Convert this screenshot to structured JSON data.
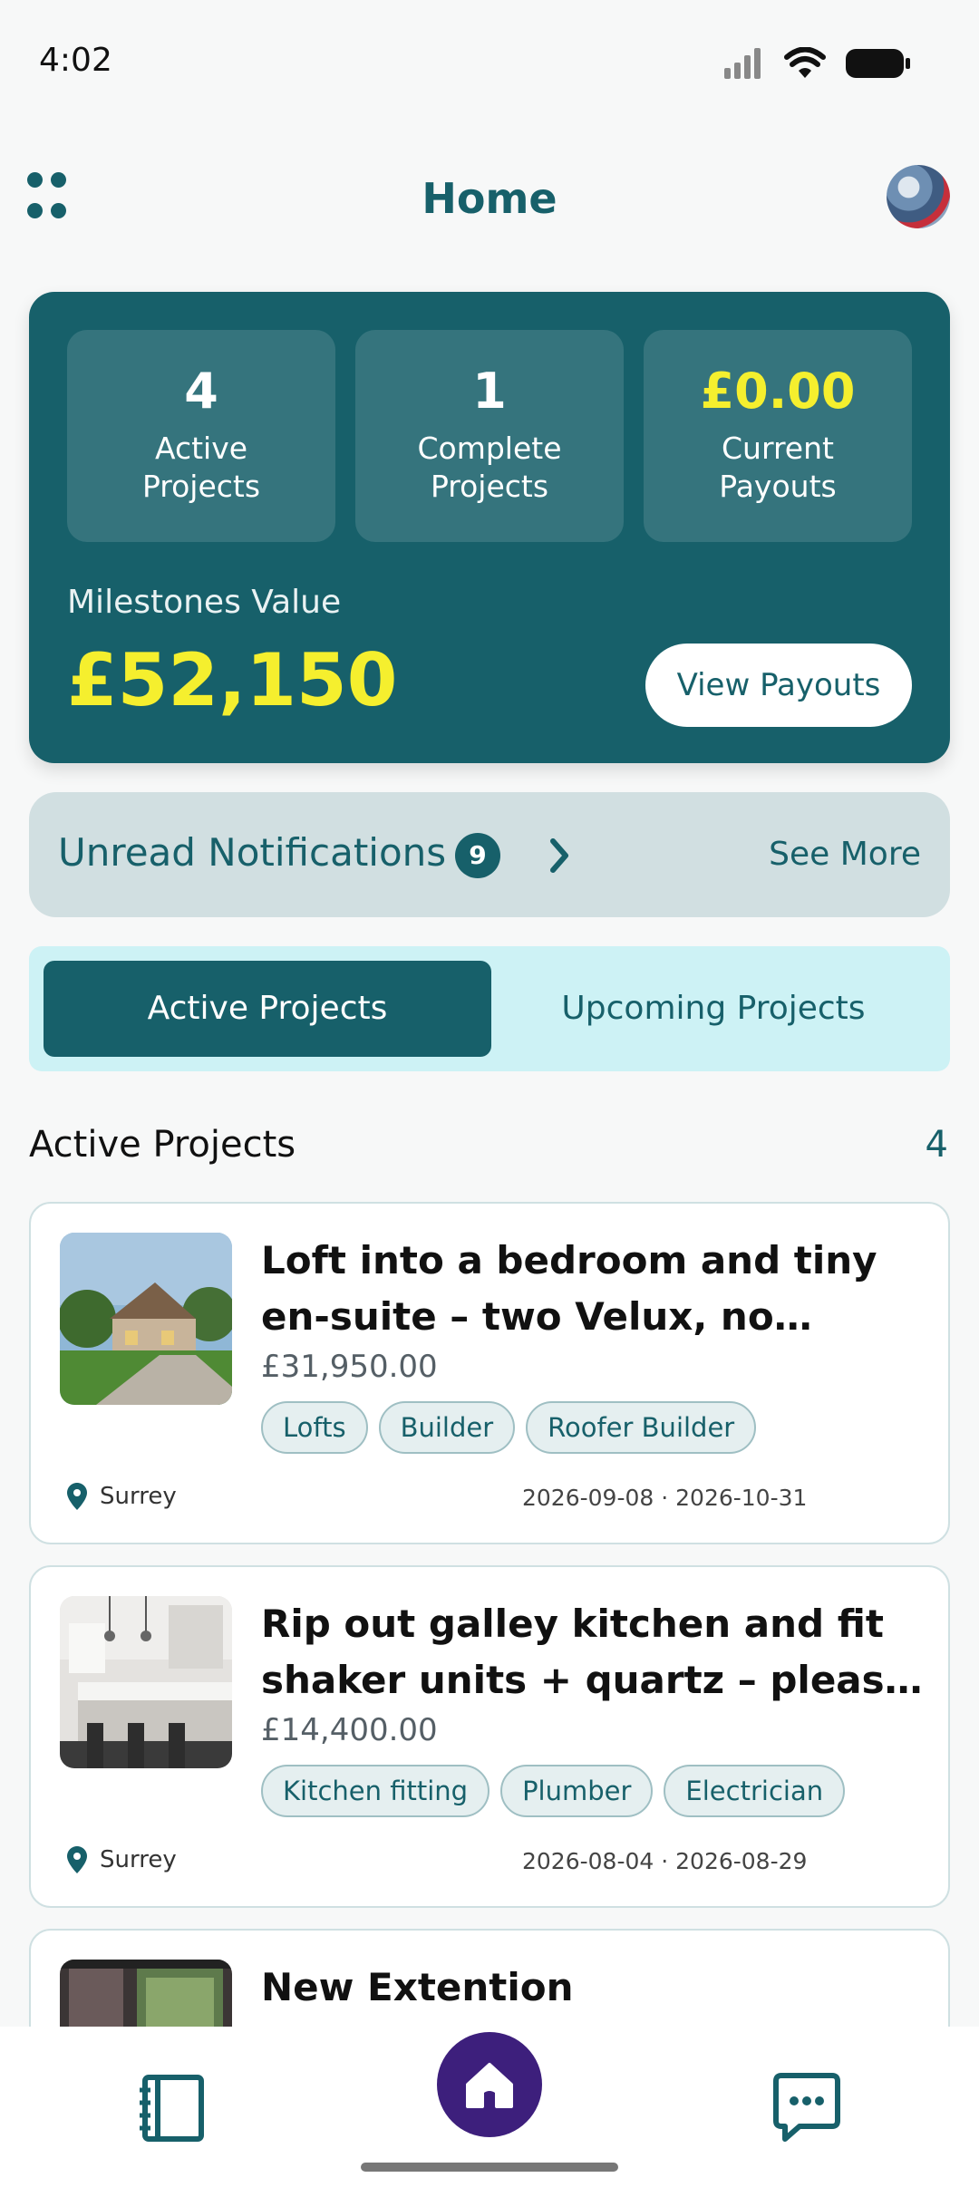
{
  "status": {
    "time": "4:02"
  },
  "header": {
    "title": "Home"
  },
  "stats": [
    {
      "value": "4",
      "label": "Active\nProjects"
    },
    {
      "value": "1",
      "label": "Complete\nProjects"
    },
    {
      "value": "£0.00",
      "label": "Current\nPayouts"
    }
  ],
  "milestones": {
    "label": "Milestones Value",
    "value": "£52,150",
    "button_label": "View Payouts"
  },
  "notifications": {
    "label": "Unread Notifications",
    "count": "9",
    "see_more": "See More"
  },
  "tabs": [
    {
      "label": "Active Projects",
      "active": true
    },
    {
      "label": "Upcoming Projects",
      "active": false
    }
  ],
  "section": {
    "title": "Active Projects",
    "count": "4"
  },
  "projects": [
    {
      "title": "Loft into a bedroom and tiny en-suite – two Velux, no dormer (neighbours object to anything bigger)",
      "price": "£31,950.00",
      "tags": [
        "Lofts",
        "Builder",
        "Roofer Builder"
      ],
      "location": "Surrey",
      "dates": "2026-09-08 · 2026-10-31"
    },
    {
      "title": "Rip out galley kitchen and fit shaker units + quartz – please leave the original floor",
      "price": "£14,400.00",
      "tags": [
        "Kitchen fitting",
        "Plumber",
        "Electrician"
      ],
      "location": "Surrey",
      "dates": "2026-08-04 · 2026-08-29"
    },
    {
      "title": "New Extention",
      "price": "",
      "tags": [],
      "location": "",
      "dates": ""
    }
  ],
  "colors": {
    "primary": "#17606a",
    "accent_yellow": "#f5ef2e",
    "home_button": "#3d1f7c",
    "tabs_bg": "#cdf2f5",
    "notif_bg": "#d1dfe1"
  },
  "nav": {
    "items": [
      "notebook-icon",
      "home-icon",
      "chat-icon"
    ]
  }
}
